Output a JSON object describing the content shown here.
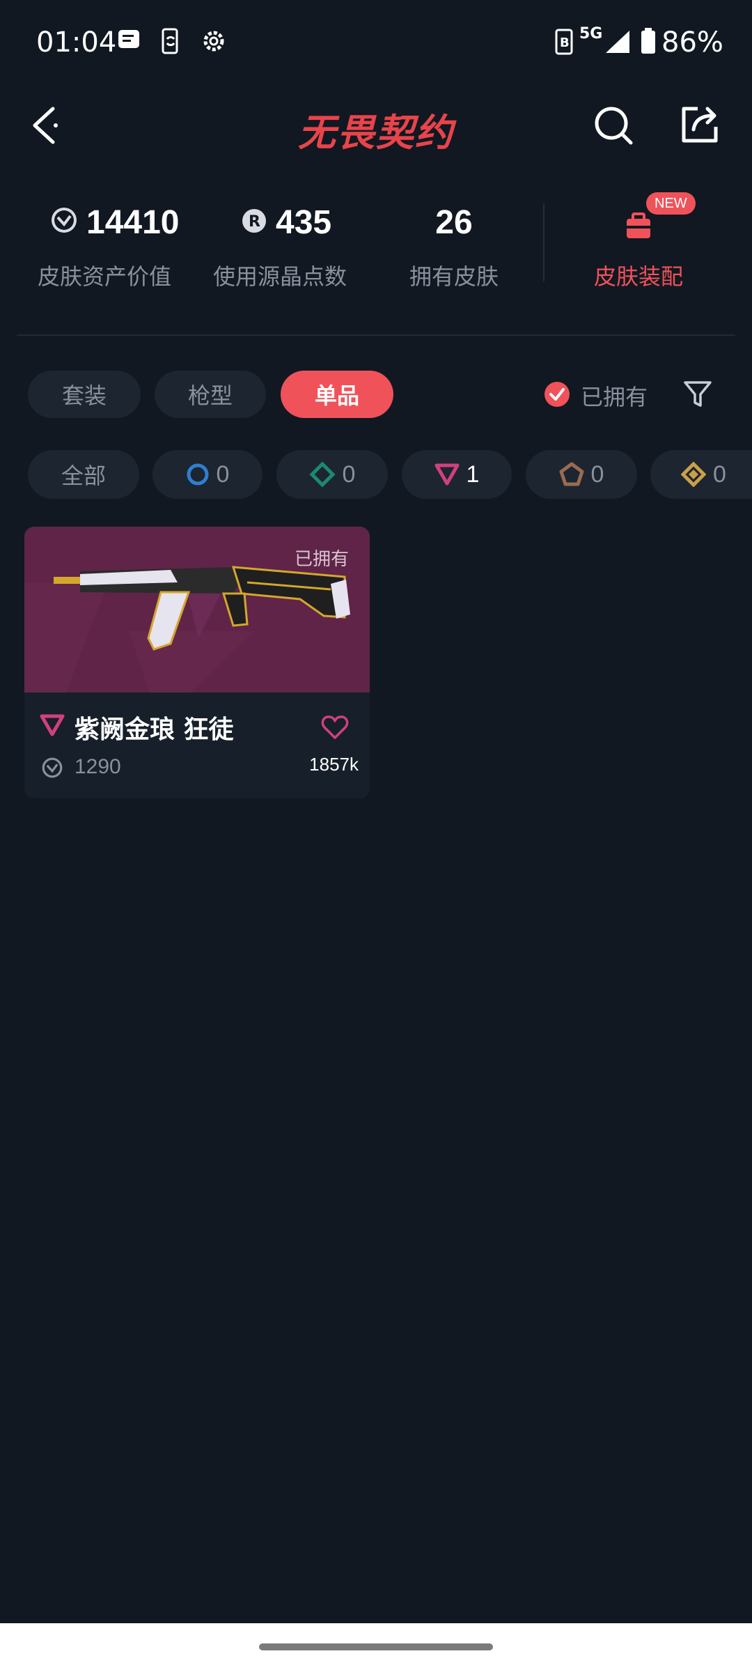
{
  "status_bar": {
    "time": "01:04",
    "network": "5G",
    "battery": "86%"
  },
  "header": {
    "title": "无畏契约",
    "icons": [
      "back-icon",
      "search-icon",
      "share-icon"
    ]
  },
  "stats": {
    "asset_value": {
      "value": "14410",
      "label": "皮肤资产价值"
    },
    "radianite": {
      "value": "435",
      "label": "使用源晶点数"
    },
    "owned": {
      "value": "26",
      "label": "拥有皮肤"
    },
    "loadout": {
      "label": "皮肤装配",
      "badge": "NEW"
    }
  },
  "tabs": [
    "套装",
    "枪型",
    "单品"
  ],
  "active_tab": "单品",
  "owned_filter": {
    "label": "已拥有",
    "checked": true
  },
  "rarity_chips": {
    "all": "全部",
    "blue": "0",
    "green": "0",
    "pink": "1",
    "brown": "0",
    "gold": "0"
  },
  "colors": {
    "accent": "#f0525a",
    "background": "#111822",
    "chip": "#1d2530",
    "pink_tier": "#d0407f"
  },
  "skins": [
    {
      "tag": "已拥有",
      "name": "紫阙金琅 狂徒",
      "price": "1290",
      "likes": "1857k"
    }
  ]
}
